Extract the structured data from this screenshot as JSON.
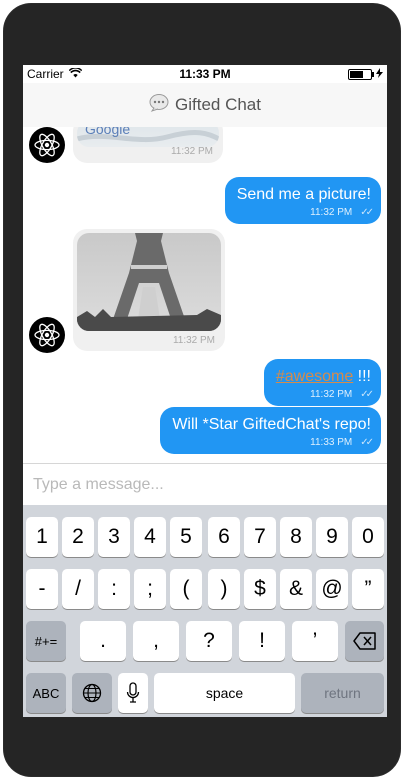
{
  "status_bar": {
    "carrier": "Carrier",
    "time": "11:33 PM"
  },
  "nav": {
    "title": "Gifted Chat"
  },
  "messages": [
    {
      "side": "left",
      "type": "image",
      "caption_image": "Google",
      "time": "11:32 PM"
    },
    {
      "side": "right",
      "text": "Send me a picture!",
      "time": "11:32 PM",
      "status": "✓✓"
    },
    {
      "side": "left",
      "type": "image",
      "time": "11:32 PM"
    },
    {
      "side": "right",
      "tag": "#awesome",
      "suffix": " !!!",
      "time": "11:32 PM",
      "status": "✓✓"
    },
    {
      "side": "right",
      "text": "Will *Star GiftedChat's repo!",
      "time": "11:33 PM",
      "status": "✓✓"
    }
  ],
  "composer": {
    "placeholder": "Type a message..."
  },
  "keyboard": {
    "row1": [
      "1",
      "2",
      "3",
      "4",
      "5",
      "6",
      "7",
      "8",
      "9",
      "0"
    ],
    "row2": [
      "-",
      "/",
      ":",
      ";",
      "(",
      ")",
      "$",
      "&",
      "@",
      "”"
    ],
    "row3_left": "#+=",
    "row3": [
      ".",
      ",",
      "?",
      "!",
      "’"
    ],
    "row4_abc": "ABC",
    "row4_space": "space",
    "row4_return": "return"
  },
  "colors": {
    "accent": "#2196f3",
    "bubble_left": "#f0f0f0",
    "keyboard_bg": "#d1d5db"
  }
}
